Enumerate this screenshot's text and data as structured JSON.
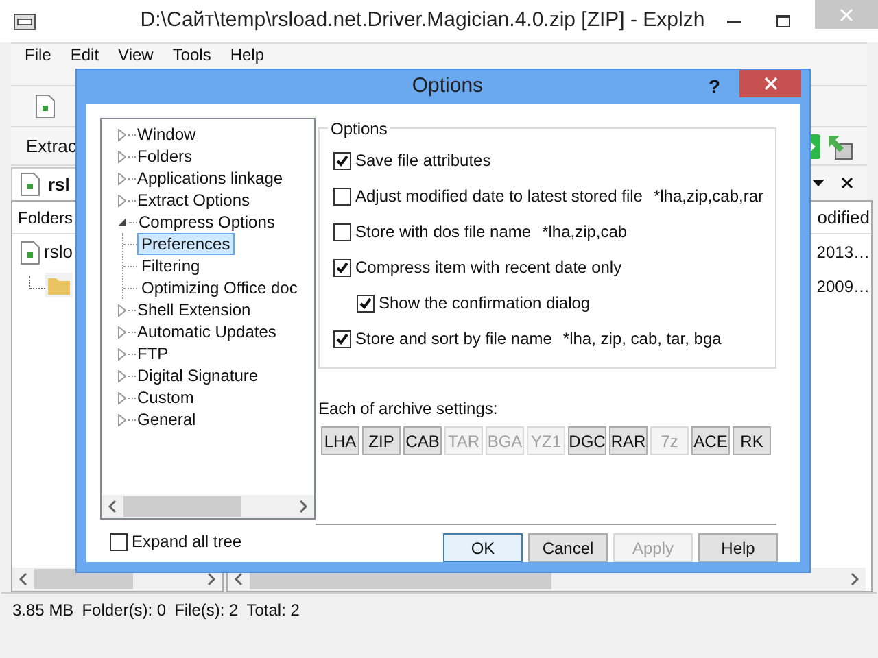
{
  "window": {
    "title": "D:\\Сайт\\temp\\rsload.net.Driver.Magician.4.0.zip [ZIP] - Explzh"
  },
  "menu": [
    {
      "label": "File"
    },
    {
      "label": "Edit"
    },
    {
      "label": "View"
    },
    {
      "label": "Tools"
    },
    {
      "label": "Help"
    }
  ],
  "toolbar": {
    "label": "Extrac"
  },
  "tab": {
    "label": "rsl"
  },
  "folders_pane": {
    "header": "Folders",
    "items": [
      {
        "label": "rslo"
      }
    ]
  },
  "file_list": {
    "column": "odified",
    "rows": [
      "2013…",
      "2009…"
    ]
  },
  "status_bar": [
    "3.85 MB",
    "Folder(s): 0",
    "File(s): 2",
    "Total: 2"
  ],
  "dialog": {
    "title": "Options",
    "help": "?",
    "tree": [
      {
        "label": "Window",
        "expanded": false
      },
      {
        "label": "Folders",
        "expanded": false
      },
      {
        "label": "Applications linkage",
        "expanded": false
      },
      {
        "label": "Extract Options",
        "expanded": false
      },
      {
        "label": "Compress Options",
        "expanded": true,
        "children": [
          {
            "label": "Preferences",
            "selected": true
          },
          {
            "label": "Filtering",
            "selected": false
          },
          {
            "label": "Optimizing Office doc",
            "selected": false
          }
        ]
      },
      {
        "label": "Shell Extension",
        "expanded": false
      },
      {
        "label": "Automatic Updates",
        "expanded": false
      },
      {
        "label": "FTP",
        "expanded": false
      },
      {
        "label": "Digital Signature",
        "expanded": false
      },
      {
        "label": "Custom",
        "expanded": false
      },
      {
        "label": "General",
        "expanded": false
      }
    ],
    "expand_all": {
      "label": "Expand all tree",
      "checked": false
    },
    "group": {
      "title": "Options",
      "options": [
        {
          "label": "Save file attributes",
          "checked": true
        },
        {
          "label": "Adjust modified date to latest stored file",
          "note": "*lha,zip,cab,rar",
          "checked": false
        },
        {
          "label": "Store with dos file name",
          "note": "*lha,zip,cab",
          "checked": false
        },
        {
          "label": "Compress item with recent date only",
          "checked": true,
          "children": [
            {
              "label": "Show the confirmation dialog",
              "checked": true
            }
          ]
        },
        {
          "label": "Store and sort by file name",
          "note": "*lha, zip, cab, tar, bga",
          "checked": true
        }
      ]
    },
    "archive_label": "Each of archive settings:",
    "archive_buttons": [
      {
        "label": "LHA",
        "disabled": false
      },
      {
        "label": "ZIP",
        "disabled": false
      },
      {
        "label": "CAB",
        "disabled": false
      },
      {
        "label": "TAR",
        "disabled": true
      },
      {
        "label": "BGA",
        "disabled": true
      },
      {
        "label": "YZ1",
        "disabled": true
      },
      {
        "label": "DGC",
        "disabled": false
      },
      {
        "label": "RAR",
        "disabled": false
      },
      {
        "label": "7z",
        "disabled": true
      },
      {
        "label": "ACE",
        "disabled": false
      },
      {
        "label": "RK",
        "disabled": false
      }
    ],
    "buttons": [
      {
        "label": "OK",
        "default": true,
        "disabled": false
      },
      {
        "label": "Cancel",
        "default": false,
        "disabled": false
      },
      {
        "label": "Apply",
        "default": false,
        "disabled": true
      },
      {
        "label": "Help",
        "default": false,
        "disabled": false
      }
    ]
  }
}
